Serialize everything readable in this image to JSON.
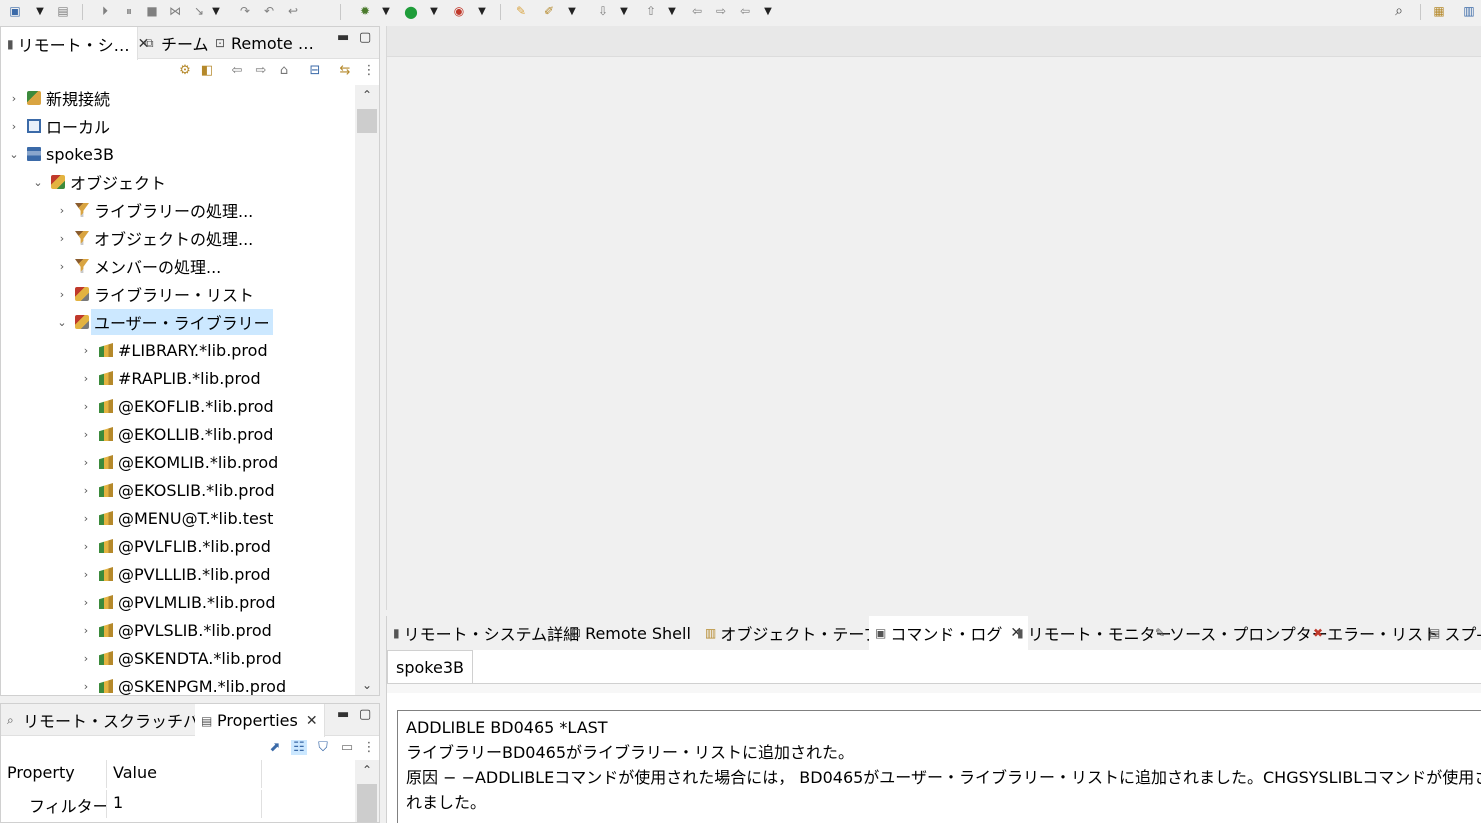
{
  "left_top_view": {
    "tabs": [
      {
        "label": "リモート・シ…",
        "icon": "remote-systems-icon",
        "closable": true
      },
      {
        "label": "チーム",
        "icon": "team-icon"
      },
      {
        "label": "Remote …",
        "icon": "remote-icon"
      }
    ],
    "tree": [
      {
        "label": "新規接続",
        "icon": "new-connection-icon",
        "level": 0,
        "state": "collapsed"
      },
      {
        "label": "ローカル",
        "icon": "local-icon",
        "level": 0,
        "state": "collapsed"
      },
      {
        "label": "spoke3B",
        "icon": "system-icon",
        "level": 0,
        "state": "expanded"
      },
      {
        "label": "オブジェクト",
        "icon": "objects-icon",
        "level": 1,
        "state": "expanded"
      },
      {
        "label": "ライブラリーの処理...",
        "icon": "filter-icon",
        "level": 2,
        "state": "collapsed"
      },
      {
        "label": "オブジェクトの処理...",
        "icon": "filter-icon",
        "level": 2,
        "state": "collapsed"
      },
      {
        "label": "メンバーの処理...",
        "icon": "filter-icon",
        "level": 2,
        "state": "collapsed"
      },
      {
        "label": "ライブラリー・リスト",
        "icon": "library-list-icon",
        "level": 2,
        "state": "collapsed"
      },
      {
        "label": "ユーザー・ライブラリー",
        "icon": "library-list-icon",
        "level": 2,
        "state": "expanded",
        "selected": true
      },
      {
        "label": "#LIBRARY.*lib.prod",
        "icon": "library-icon",
        "level": 3,
        "state": "collapsed"
      },
      {
        "label": "#RAPLIB.*lib.prod",
        "icon": "library-icon",
        "level": 3,
        "state": "collapsed"
      },
      {
        "label": "@EKOFLIB.*lib.prod",
        "icon": "library-icon",
        "level": 3,
        "state": "collapsed"
      },
      {
        "label": "@EKOLLIB.*lib.prod",
        "icon": "library-icon",
        "level": 3,
        "state": "collapsed"
      },
      {
        "label": "@EKOMLIB.*lib.prod",
        "icon": "library-icon",
        "level": 3,
        "state": "collapsed"
      },
      {
        "label": "@EKOSLIB.*lib.prod",
        "icon": "library-icon",
        "level": 3,
        "state": "collapsed"
      },
      {
        "label": "@MENU@T.*lib.test",
        "icon": "library-icon",
        "level": 3,
        "state": "collapsed"
      },
      {
        "label": "@PVLFLIB.*lib.prod",
        "icon": "library-icon",
        "level": 3,
        "state": "collapsed"
      },
      {
        "label": "@PVLLLIB.*lib.prod",
        "icon": "library-icon",
        "level": 3,
        "state": "collapsed"
      },
      {
        "label": "@PVLMLIB.*lib.prod",
        "icon": "library-icon",
        "level": 3,
        "state": "collapsed"
      },
      {
        "label": "@PVLSLIB.*lib.prod",
        "icon": "library-icon",
        "level": 3,
        "state": "collapsed"
      },
      {
        "label": "@SKENDTA.*lib.prod",
        "icon": "library-icon",
        "level": 3,
        "state": "collapsed"
      },
      {
        "label": "@SKENPGM.*lib.prod",
        "icon": "library-icon",
        "level": 3,
        "state": "collapsed"
      }
    ]
  },
  "left_bottom_view": {
    "tabs": [
      {
        "label": "リモート・スクラッチパッド",
        "icon": "scratchpad-icon"
      },
      {
        "label": "Properties",
        "icon": "properties-icon",
        "closable": true
      }
    ],
    "columns": [
      "Property",
      "Value"
    ],
    "rows": [
      {
        "property": "フィルター・",
        "value": "1"
      }
    ]
  },
  "bottom_panel": {
    "tabs": [
      {
        "label": "リモート・システム詳細",
        "icon": "remote-system-details-icon"
      },
      {
        "label": "Remote Shell",
        "icon": "remote-shell-icon"
      },
      {
        "label": "オブジェクト・テーブル",
        "icon": "object-table-icon"
      },
      {
        "label": "コマンド・ログ",
        "icon": "command-log-icon",
        "closable": true
      },
      {
        "label": "リモート・モニター",
        "icon": "remote-monitor-icon"
      },
      {
        "label": "ソース・プロンプター",
        "icon": "source-prompter-icon"
      },
      {
        "label": "エラー・リスト",
        "icon": "error-list-icon"
      },
      {
        "label": "スプ-",
        "icon": "spool-icon"
      }
    ],
    "subtab": "spoke3B",
    "log_lines": [
      "ADDLIBLE BD0465 *LAST",
      "ライブラリーBD0465がライブラリー・リストに追加された。",
      "原因 − −ADDLIBLEコマンドが使用された場合には， BD0465がユーザー・ライブラリー・リストに追加されました。CHGSYSLIBLコマンドが使用された場合には",
      "れました。"
    ]
  }
}
